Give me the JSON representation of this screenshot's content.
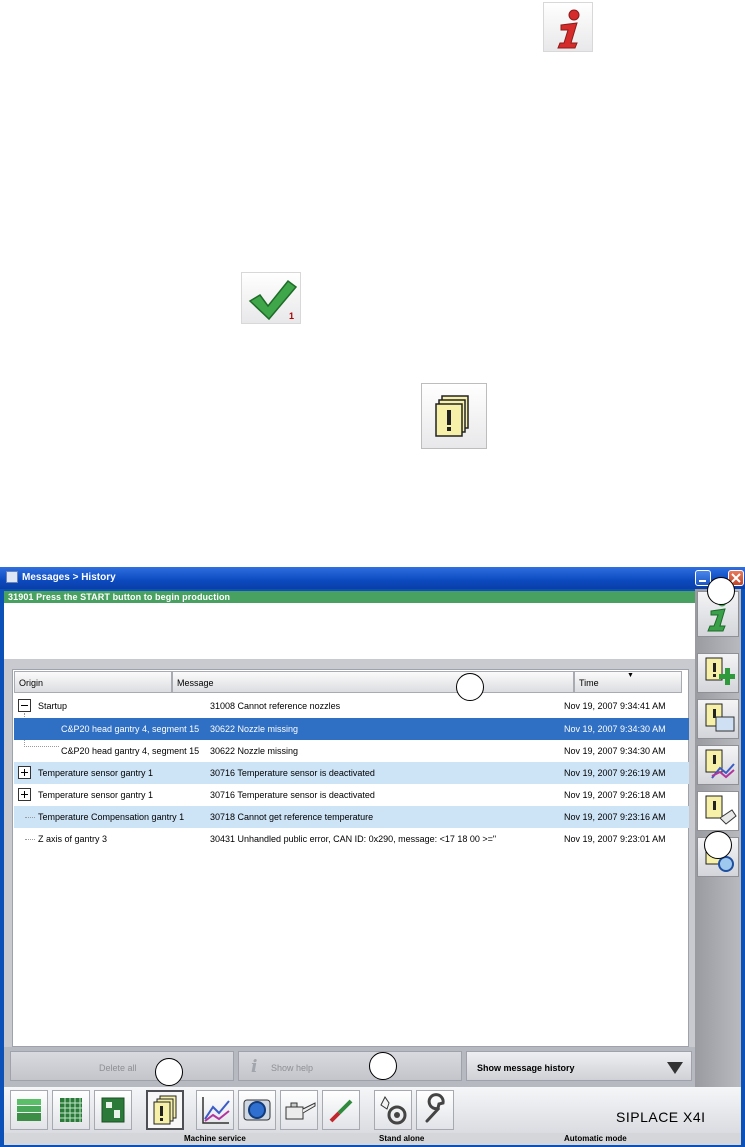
{
  "window": {
    "title": "Messages > History",
    "status_message": "31901 Press the START button to begin production"
  },
  "table": {
    "headers": {
      "origin": "Origin",
      "message": "Message",
      "time": "Time"
    },
    "rows": [
      {
        "origin": "Startup",
        "message": "31008 Cannot reference nozzles",
        "time": "Nov 19, 2007 9:34:41 AM"
      },
      {
        "origin": "C&P20 head gantry 4, segment 15",
        "message": "30622 Nozzle missing",
        "time": "Nov 19, 2007 9:34:30 AM"
      },
      {
        "origin": "C&P20 head gantry 4, segment 15",
        "message": "30622 Nozzle missing",
        "time": "Nov 19, 2007 9:34:30 AM"
      },
      {
        "origin": "Temperature sensor gantry 1",
        "message": "30716 Temperature sensor is deactivated",
        "time": "Nov 19, 2007 9:26:19 AM"
      },
      {
        "origin": "Temperature sensor gantry 1",
        "message": "30716 Temperature sensor is deactivated",
        "time": "Nov 19, 2007 9:26:18 AM"
      },
      {
        "origin": "Temperature Compensation gantry 1",
        "message": "30718 Cannot get reference temperature",
        "time": "Nov 19, 2007 9:23:16 AM"
      },
      {
        "origin": "Z axis of gantry 3",
        "message": "30431 Unhandled public error, CAN ID: 0x290, message: <17 18 00 >=\"",
        "time": "Nov 19, 2007 9:23:01 AM"
      }
    ]
  },
  "actions": {
    "delete_all": "Delete all",
    "show_help": "Show help",
    "history_select": "Show message history"
  },
  "ref_icons": {
    "check_badge": "1"
  },
  "brand": "SIPLACE X4I",
  "footer": {
    "machine_service": "Machine service",
    "stand_alone": "Stand alone",
    "automatic_mode": "Automatic mode"
  },
  "colors": {
    "status_bar": "#48a160",
    "selected_row": "#2f6fc4",
    "alt_row": "#cde3f6",
    "title_bar": "#0c4ac0",
    "info_icon": "#d62b2b"
  },
  "icons": {
    "ref_info": "info-icon",
    "ref_check": "checkmark-icon",
    "ref_warning": "warning-messages-icon",
    "sidebar": [
      "info-icon",
      "add-message-icon",
      "screen-message-icon",
      "chart-message-icon",
      "clear-messages-icon",
      "search-message-icon"
    ],
    "toolbar": [
      "stack-icon",
      "grid-icon",
      "board-icon",
      "messages-icon",
      "chart-icon",
      "camera-icon",
      "oil-can-icon",
      "cable-icon",
      "gear-hand-icon",
      "wrench-icon"
    ]
  }
}
